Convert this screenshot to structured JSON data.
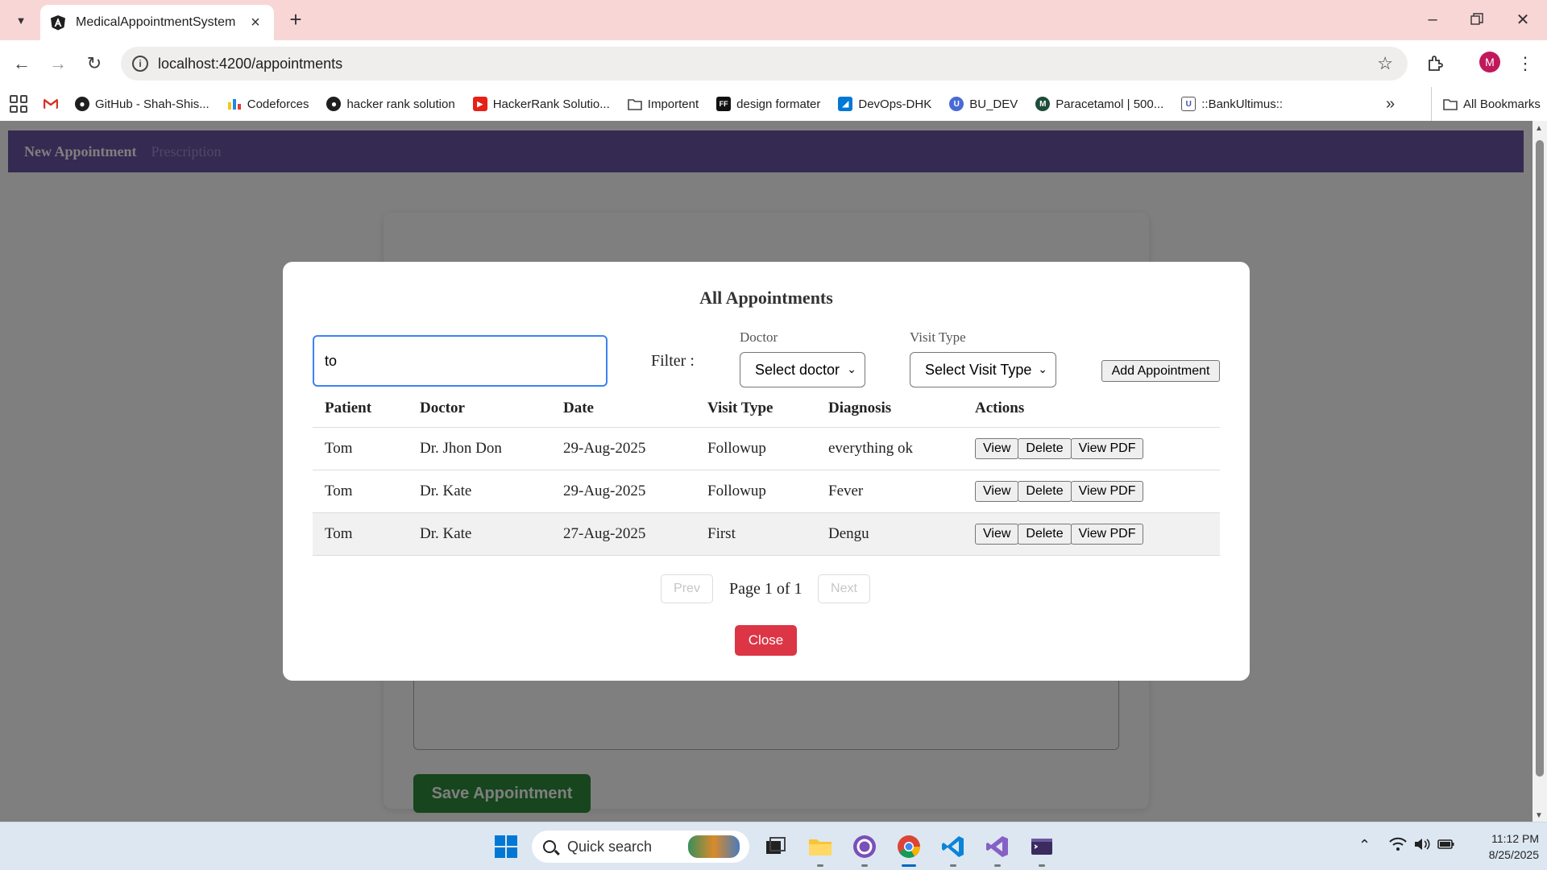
{
  "browser": {
    "tab_title": "MedicalAppointmentSystem",
    "url": "localhost:4200/appointments",
    "avatar_letter": "M",
    "bookmarks": [
      {
        "label": "GitHub - Shah-Shis...",
        "icon": "github-icon"
      },
      {
        "label": "Codeforces",
        "icon": "codeforces-icon"
      },
      {
        "label": "hacker rank solution",
        "icon": "github-icon"
      },
      {
        "label": "HackerRank Solutio...",
        "icon": "youtube-icon"
      },
      {
        "label": "Importent",
        "icon": "folder-icon"
      },
      {
        "label": "design formater",
        "icon": "ff-icon"
      },
      {
        "label": "DevOps-DHK",
        "icon": "azure-devops-icon"
      },
      {
        "label": "BU_DEV",
        "icon": "shield-icon"
      },
      {
        "label": "Paracetamol | 500...",
        "icon": "m-logo-icon"
      },
      {
        "label": "::BankUltimus::",
        "icon": "bank-icon"
      }
    ],
    "all_bookmarks_label": "All Bookmarks"
  },
  "app": {
    "nav": {
      "new_appointment": "New Appointment",
      "prescription": "Prescription"
    },
    "background": {
      "save_button": "Save Appointment"
    }
  },
  "modal": {
    "title": "All Appointments",
    "search_value": "to",
    "filter_label": "Filter :",
    "doctor_label": "Doctor",
    "doctor_select": "Select doctor",
    "visit_type_label": "Visit Type",
    "visit_type_select": "Select Visit Type",
    "add_button": "Add Appointment",
    "columns": [
      "Patient",
      "Doctor",
      "Date",
      "Visit Type",
      "Diagnosis",
      "Actions"
    ],
    "rows": [
      {
        "patient": "Tom",
        "doctor": "Dr. Jhon Don",
        "date": "29-Aug-2025",
        "visit_type": "Followup",
        "diagnosis": "everything ok"
      },
      {
        "patient": "Tom",
        "doctor": "Dr. Kate",
        "date": "29-Aug-2025",
        "visit_type": "Followup",
        "diagnosis": "Fever"
      },
      {
        "patient": "Tom",
        "doctor": "Dr. Kate",
        "date": "27-Aug-2025",
        "visit_type": "First",
        "diagnosis": "Dengu"
      }
    ],
    "actions": {
      "view": "View",
      "delete": "Delete",
      "view_pdf": "View PDF"
    },
    "pager": {
      "prev": "Prev",
      "page_text": "Page 1 of 1",
      "next": "Next"
    },
    "close_button": "Close",
    "colors": {
      "close": "#dc3545",
      "nav": "#6b55a5",
      "save": "#2e8b3a",
      "focus": "#3b82f6"
    }
  },
  "taskbar": {
    "search_placeholder": "Quick search",
    "time": "11:12 PM",
    "date": "8/25/2025"
  }
}
